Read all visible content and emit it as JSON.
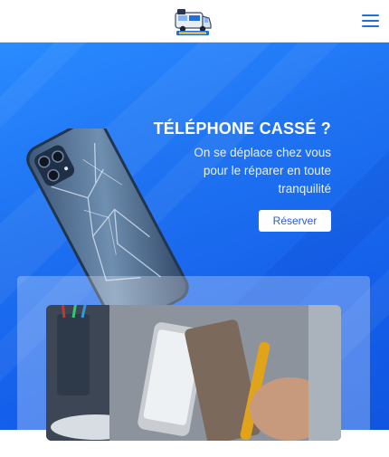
{
  "header": {
    "logo_icon": "repair-van-logo",
    "menu_icon": "hamburger-menu-icon",
    "accent_color": "#1f6fe0"
  },
  "hero": {
    "background_colors": [
      "#2a8bff",
      "#0f55e0"
    ],
    "image_icon": "broken-phone-image",
    "title": "TÉLÉPHONE CASSÉ ?",
    "subtitle_line1": "On se déplace chez vous",
    "subtitle_line2": "pour le réparer en toute",
    "subtitle_line3": "tranquilité",
    "cta_label": "Réserver"
  },
  "feature_card": {
    "image_icon": "phone-repair-photo"
  }
}
